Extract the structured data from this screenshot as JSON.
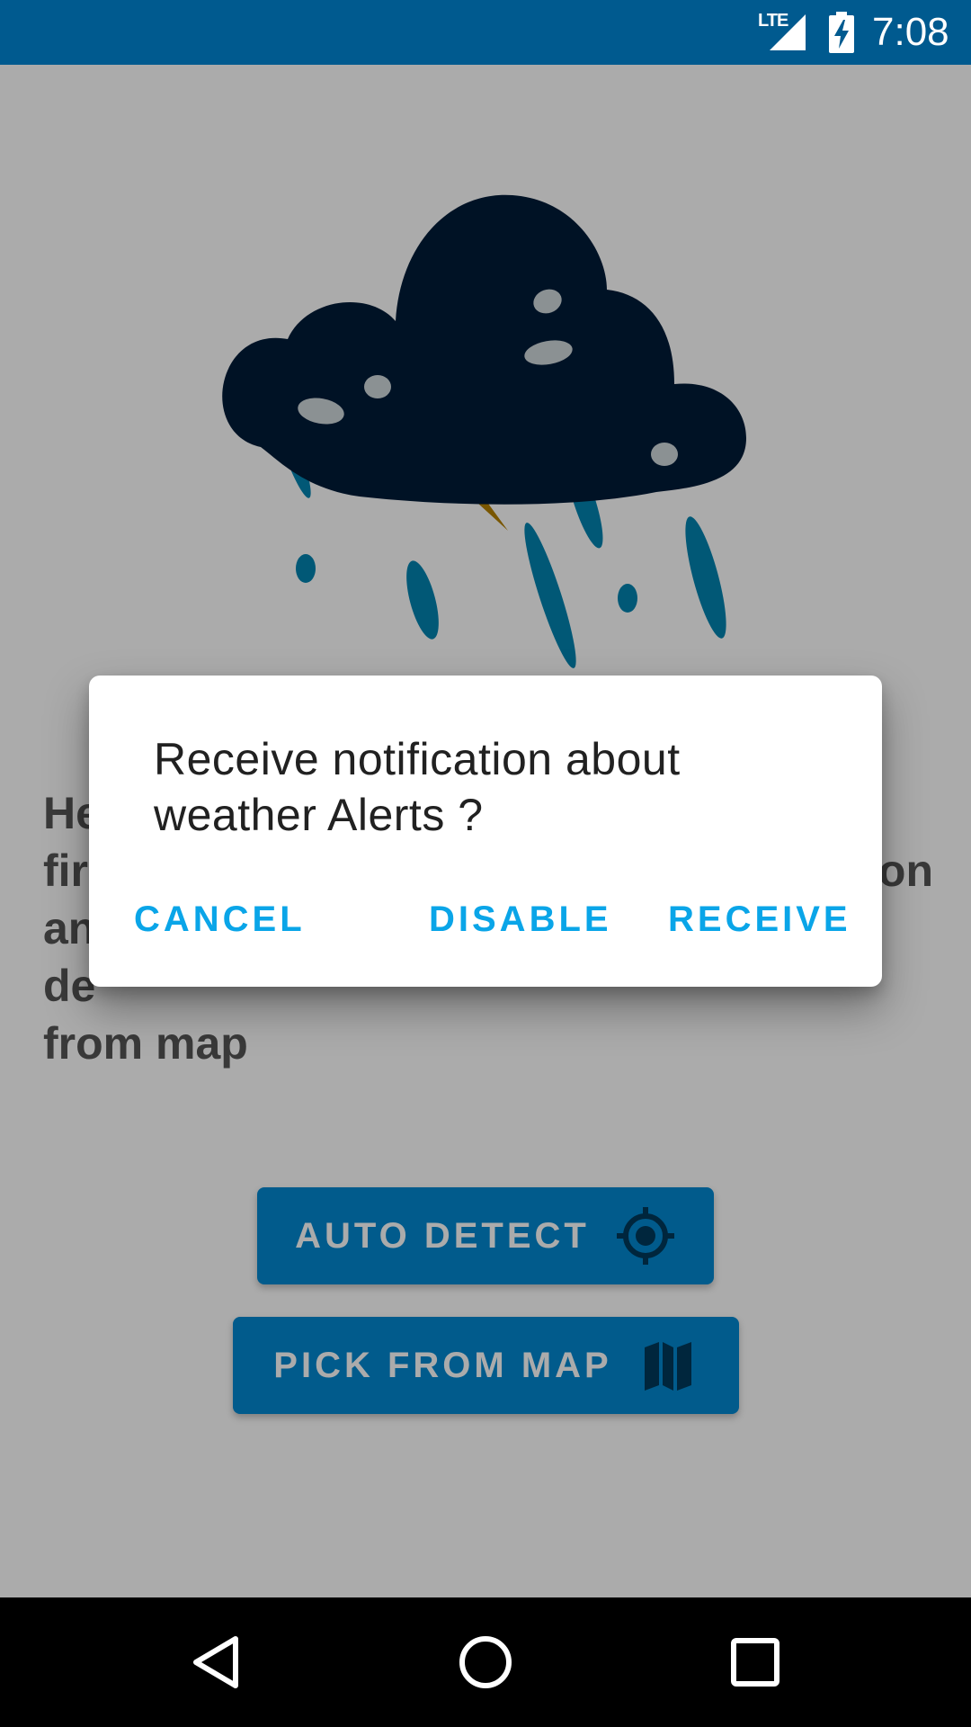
{
  "status_bar": {
    "network": "LTE",
    "time": "7:08",
    "icons": [
      "signal-icon",
      "battery-charging-icon"
    ]
  },
  "screen": {
    "illustration": "storm-cloud-illustration",
    "intro_lines": [
      "He",
      "fir",
      "an",
      "de",
      "from map"
    ],
    "intro_visible_right": [
      "on"
    ],
    "buttons": {
      "auto_detect": {
        "label": "AUTO DETECT",
        "icon": "location-target-icon"
      },
      "pick_from_map": {
        "label": "PICK FROM MAP",
        "icon": "map-icon"
      }
    },
    "colors": {
      "button": "#0288d1",
      "cloud": "#001b38",
      "rain": "#0284b0",
      "bolt": "#b58000"
    }
  },
  "dialog": {
    "message": "Receive notification about weather Alerts ?",
    "cancel_label": "CANCEL",
    "disable_label": "DISABLE",
    "receive_label": "RECEIVE",
    "accent": "#0aa5e8"
  },
  "nav_bar": {
    "icons": [
      "back-icon",
      "home-icon",
      "recents-icon"
    ]
  }
}
